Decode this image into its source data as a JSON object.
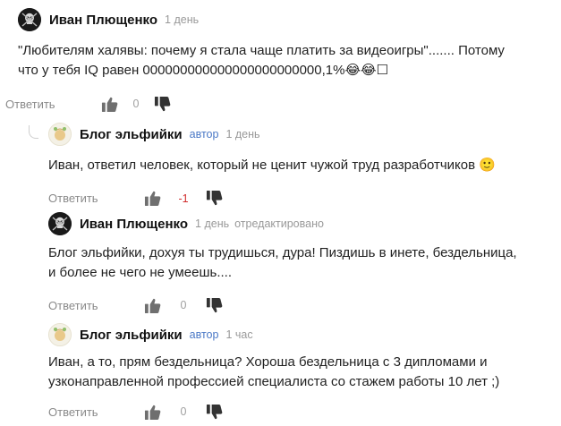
{
  "comments": [
    {
      "author": "Иван Плющенко",
      "time": "1 день",
      "text_lines": [
        "\"Любителям халявы: почему я стала чаще платить за видеоигры\"....... Потому",
        "что у тебя IQ равен 000000000000000000000000,1%😂😂☐"
      ],
      "reply_label": "Ответить",
      "score": "0"
    },
    {
      "author": "Блог эльфийки",
      "badge": "автор",
      "time": "1 день",
      "text_lines": [
        "Иван, ответил человек, который не ценит чужой труд разработчиков 🙂"
      ],
      "reply_label": "Ответить",
      "score": "-1"
    },
    {
      "author": "Иван Плющенко",
      "time": "1 день",
      "edited": "отредактировано",
      "text_lines": [
        "Блог эльфийки, дохуя ты трудишься, дура! Пиздишь в инете, бездельница,",
        "и более не чего не умеешь...."
      ],
      "reply_label": "Ответить",
      "score": "0"
    },
    {
      "author": "Блог эльфийки",
      "badge": "автор",
      "time": "1 час",
      "text_lines": [
        "Иван, а то, прям бездельница? Хороша бездельница с 3 дипломами и",
        "узконаправленной профессией специалиста со стажем работы 10 лет ;)"
      ],
      "reply_label": "Ответить",
      "score": "0"
    }
  ],
  "colors": {
    "author_badge": "#4a78c6",
    "muted": "#999999",
    "negative_score": "#d02c2c",
    "icon": "#6f6f6f",
    "icon_dislike": "#333333"
  }
}
